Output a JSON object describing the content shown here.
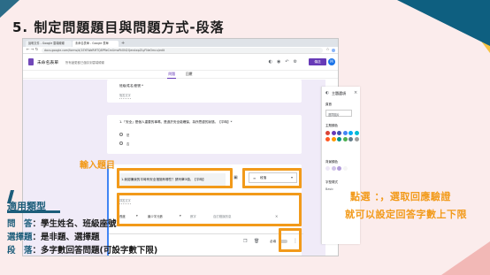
{
  "slide": {
    "title": "5. 制定問題題目與問題方式-段落",
    "annotation_input_title": "輸入題目",
    "callout_line1": "點選 ：，選取回應驗證",
    "callout_line2": "就可以設定回答字數上下限",
    "applicable_heading": "適用類型",
    "info": [
      {
        "key": "問　答",
        "value": "：學生姓名、班級座號"
      },
      {
        "key": "選擇題",
        "value": "：是非題、選擇題"
      },
      {
        "key": "段　落",
        "value": "：多字數回答問題(可設字數下限)"
      }
    ]
  },
  "browser": {
    "tabs": [
      {
        "label": "說明文件 - Google 雲端硬碟"
      },
      {
        "label": "未命名表單 - Google 表單"
      }
    ],
    "url": "docs.google.com/forms/d/1SYEWaRMTQ8PReCmUmxRtON2QerxlwpZLyFNeOmcu/edit",
    "accent_color": "#673ab7"
  },
  "form": {
    "title": "未命名表單",
    "saved_status": "所有變更都已儲存到雲端硬碟",
    "send_label": "傳送",
    "avatar_letter": "M",
    "tabs": [
      "問題",
      "回覆"
    ],
    "q_prev_label": "班級/姓名/座號 *",
    "q_prev_hint": "簡答文字",
    "q2_text": "1.「安全」是個人重要的事嗎，是過於安全能確保，為所思慮的狀態。【平時】*",
    "q2_options": [
      "是",
      "否"
    ],
    "active_question": "1.我認識我的平時有安全措施有哪些？請列舉3項。【平時】",
    "active_type": "段落",
    "answer_hint": "詳答文字",
    "validation_type": "長度",
    "validation_op": "最少字元數",
    "validation_num": "數字",
    "validation_error": "自訂錯誤訊息",
    "required_label": "必填",
    "side_icons": [
      "plus-circle-icon",
      "import-icon",
      "title-icon",
      "image-icon",
      "video-icon",
      "section-icon"
    ]
  },
  "theme_panel": {
    "title": "主題選項",
    "header_label": "頁首",
    "choose_image": "選擇圖片",
    "theme_color_label": "主題顏色",
    "theme_colors": [
      "#db4437",
      "#673ab7",
      "#3f51b5",
      "#4285f4",
      "#03a9f4",
      "#00bcd4",
      "#ff5722",
      "#ff9800",
      "#009688",
      "#4caf50",
      "#607d8b",
      "#9e9e9e"
    ],
    "bg_color_label": "背景顏色",
    "bg_colors": [
      "#ede7f6",
      "#d1c4e9",
      "#b39ddb",
      "#f5f5f5"
    ],
    "font_label": "字型樣式",
    "font_value": "Basic"
  }
}
